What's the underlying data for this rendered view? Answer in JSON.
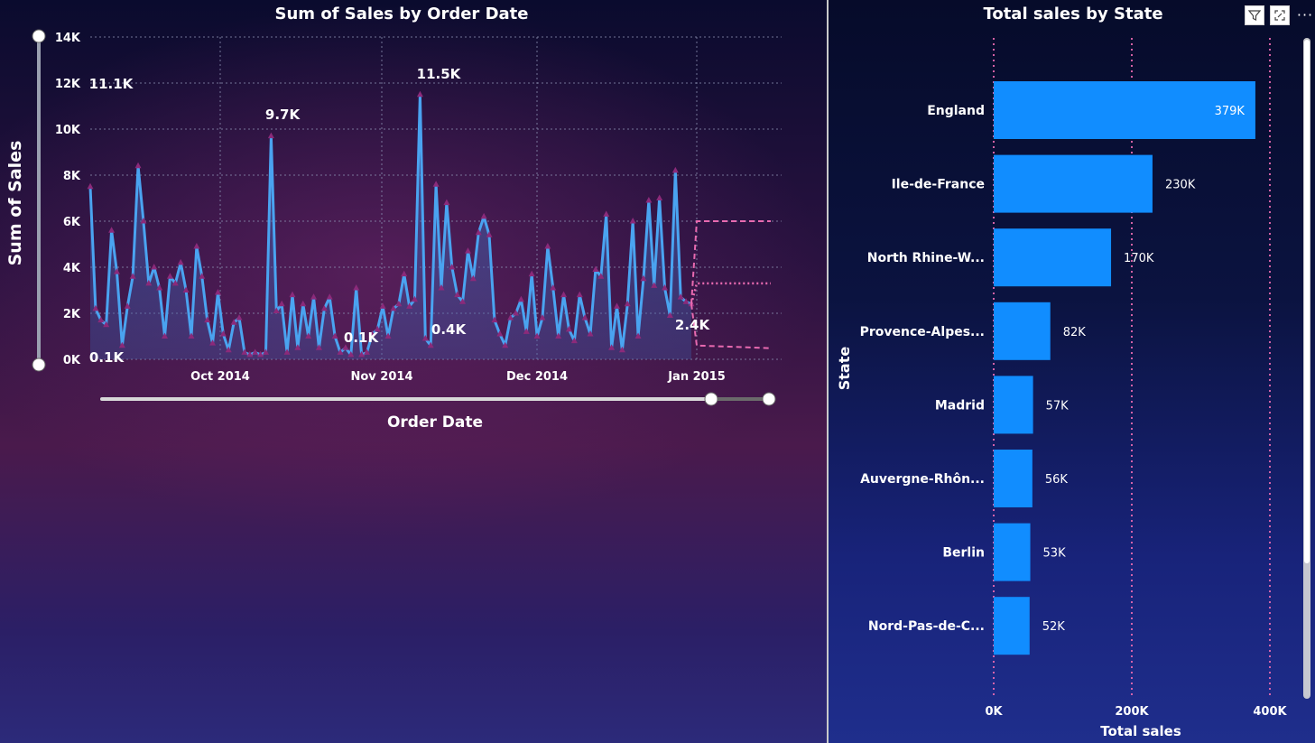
{
  "line_visual": {
    "title": "Sum of Sales by Order Date",
    "xlabel": "Order Date",
    "ylabel": "Sum of Sales",
    "y_ticks": [
      "0K",
      "2K",
      "4K",
      "6K",
      "8K",
      "10K",
      "12K",
      "14K"
    ],
    "x_ticks": [
      "Oct 2014",
      "Nov 2014",
      "Dec 2014",
      "Jan 2015"
    ],
    "data_labels": [
      "11.1K",
      "9.7K",
      "11.5K",
      "0.1K",
      "0.1K",
      "0.4K",
      "2.4K"
    ]
  },
  "bar_visual": {
    "title": "Total sales by State",
    "ylabel": "State",
    "xlabel": "Total sales",
    "x_ticks": [
      "0K",
      "200K",
      "400K"
    ],
    "categories": [
      "England",
      "Ile-de-France",
      "North Rhine-W...",
      "Provence-Alpes...",
      "Madrid",
      "Auvergne-Rhôn...",
      "Berlin",
      "Nord-Pas-de-C..."
    ],
    "value_labels": [
      "379K",
      "230K",
      "170K",
      "82K",
      "57K",
      "56K",
      "53K",
      "52K"
    ]
  },
  "header_icons": [
    "filter-icon",
    "focus-mode-icon",
    "more-options-icon"
  ],
  "colors": {
    "line": "#4aa3f0",
    "marker": "#8b2a7a",
    "bar": "#118dff",
    "forecast": "#e86ab0",
    "grid": "#8a8fb0"
  },
  "chart_data": [
    {
      "type": "line",
      "title": "Sum of Sales by Order Date",
      "xlabel": "Order Date",
      "ylabel": "Sum of Sales",
      "ylim": [
        0,
        14000
      ],
      "x_range": [
        "2014-09-01",
        "2015-01-05"
      ],
      "x_ticks": [
        "Oct 2014",
        "Nov 2014",
        "Dec 2014",
        "Jan 2015"
      ],
      "grid": true,
      "series": [
        {
          "values": [
            7500,
            2200,
            1700,
            1500,
            5600,
            3800,
            600,
            2300,
            3600,
            8400,
            6000,
            3300,
            4000,
            3100,
            1000,
            3600,
            3300,
            4200,
            3000,
            1000,
            4900,
            3600,
            1700,
            700,
            2900,
            1100,
            400,
            1600,
            1800,
            300,
            200,
            300,
            200,
            300,
            9700,
            2100,
            2400,
            300,
            2800,
            500,
            2400,
            1000,
            2700,
            500,
            2200,
            2700,
            1000,
            300,
            500,
            200,
            3100,
            200,
            300,
            1100,
            1300,
            2300,
            1000,
            2200,
            2400,
            3700,
            2300,
            2600,
            11500,
            900,
            600,
            7600,
            3100,
            6800,
            4000,
            2800,
            2500,
            4700,
            3500,
            5500,
            6200,
            5400,
            1700,
            1100,
            600,
            1800,
            2000,
            2600,
            1200,
            3700,
            1000,
            1800,
            4900,
            3100,
            1000,
            2800,
            1300,
            800,
            2800,
            1800,
            1100,
            3900,
            3600,
            6300,
            500,
            2300,
            400,
            2400,
            6000,
            1000,
            3500,
            6900,
            3200,
            7000,
            3100,
            1900,
            8200,
            2700,
            2500,
            2400
          ]
        },
        {
          "name": "Forecast",
          "type": "forecast",
          "x_range": [
            "2015-01-01",
            "2015-01-16"
          ],
          "upper": 6000,
          "forecast": 3300,
          "lower": 600
        }
      ]
    },
    {
      "type": "bar",
      "orientation": "horizontal",
      "title": "Total sales by State",
      "xlabel": "Total sales",
      "ylabel": "State",
      "categories": [
        "England",
        "Ile-de-France",
        "North Rhine-W...",
        "Provence-Alpes...",
        "Madrid",
        "Auvergne-Rhôn...",
        "Berlin",
        "Nord-Pas-de-C..."
      ],
      "values": [
        379000,
        230000,
        170000,
        82000,
        57000,
        56000,
        53000,
        52000
      ],
      "xlim": [
        0,
        400000
      ],
      "grid": true
    }
  ]
}
